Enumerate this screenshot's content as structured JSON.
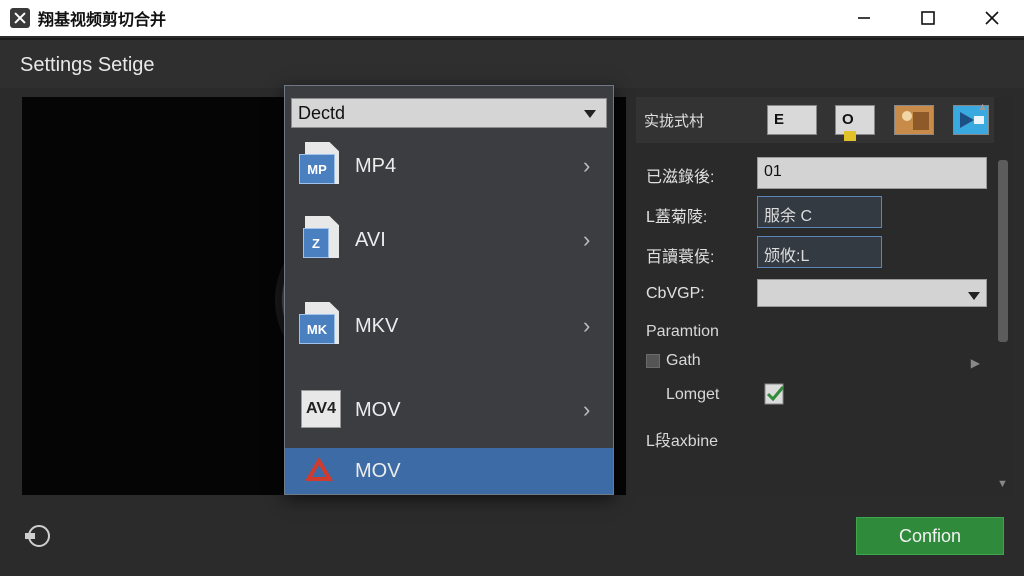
{
  "window": {
    "title": "翔基视频剪切合并",
    "minimize_icon": "minimize-icon",
    "maximize_icon": "maximize-icon",
    "close_icon": "close-icon"
  },
  "header": {
    "title": "Settings Setige"
  },
  "dropdown": {
    "selected_value": "Dectd",
    "items": [
      {
        "label": "MP4",
        "icon": "mp4-file-icon",
        "badge": "MP"
      },
      {
        "label": "AVI",
        "icon": "avi-file-icon"
      },
      {
        "label": "MKV",
        "icon": "mkv-file-icon",
        "badge": "MK"
      },
      {
        "label": "MOV",
        "icon": "mov-av4-icon",
        "badge": "AV4"
      },
      {
        "label": "MOV",
        "icon": "mov-triangle-icon",
        "selected": true
      }
    ]
  },
  "right_panel": {
    "tool_label": "实拢式村",
    "tool_buttons": [
      {
        "label": "E",
        "icon": "e-button-icon"
      },
      {
        "label": "O",
        "icon": "media-tool-icon"
      },
      {
        "label": "",
        "icon": "photo-icon"
      },
      {
        "label": "",
        "icon": "image-transfer-icon"
      }
    ],
    "fields": [
      {
        "label": "已滋錄後:",
        "value": "01"
      },
      {
        "label": "L蓋菊陵:",
        "value": "服余 C"
      },
      {
        "label": "百讀蓑侯:",
        "value": "颁攸:L"
      }
    ],
    "select_field": {
      "label": "CbVGP:",
      "value": ""
    },
    "section": {
      "title": "Paramtion",
      "checkbox_label": "Gath",
      "toggle_label": "Lomget",
      "footer_label": "L段axbine"
    }
  },
  "footer": {
    "confirm_label": "Confion",
    "restore_icon": "restore-icon"
  },
  "colors": {
    "accent": "#3d6ba5",
    "confirm": "#2f8a3b",
    "background": "#2b2b2b"
  }
}
